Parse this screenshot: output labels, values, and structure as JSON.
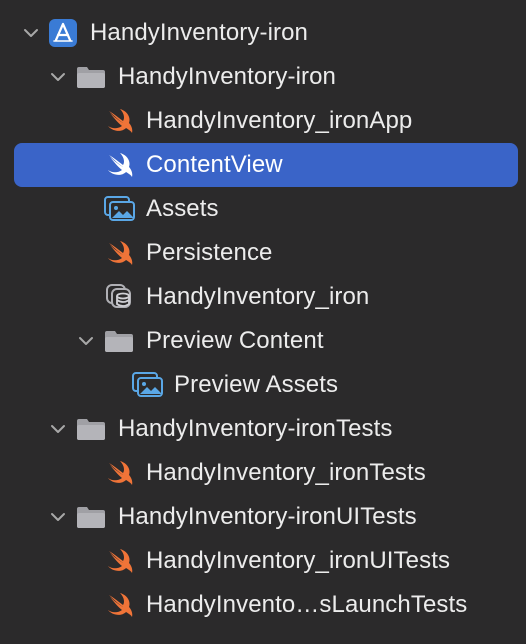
{
  "navigator": {
    "items": [
      {
        "label": "HandyInventory-iron",
        "type": "project",
        "expanded": true
      },
      {
        "label": "HandyInventory-iron",
        "type": "folder",
        "expanded": true
      },
      {
        "label": "HandyInventory_ironApp",
        "type": "swift"
      },
      {
        "label": "ContentView",
        "type": "swift",
        "selected": true
      },
      {
        "label": "Assets",
        "type": "assets"
      },
      {
        "label": "Persistence",
        "type": "swift"
      },
      {
        "label": "HandyInventory_iron",
        "type": "datamodel"
      },
      {
        "label": "Preview Content",
        "type": "folder",
        "expanded": true
      },
      {
        "label": "Preview Assets",
        "type": "assets"
      },
      {
        "label": "HandyInventory-ironTests",
        "type": "folder",
        "expanded": true
      },
      {
        "label": "HandyInventory_ironTests",
        "type": "swift"
      },
      {
        "label": "HandyInventory-ironUITests",
        "type": "folder",
        "expanded": true
      },
      {
        "label": "HandyInventory_ironUITests",
        "type": "swift"
      },
      {
        "label": "HandyInvento…sLaunchTests",
        "type": "swift"
      }
    ]
  },
  "colors": {
    "background": "#2b2a2b",
    "selection": "#3a64c8",
    "swift": "#f07438",
    "folder": "#a0a0a5",
    "assets": "#5aa7e6",
    "project": "#3a7bd5"
  }
}
